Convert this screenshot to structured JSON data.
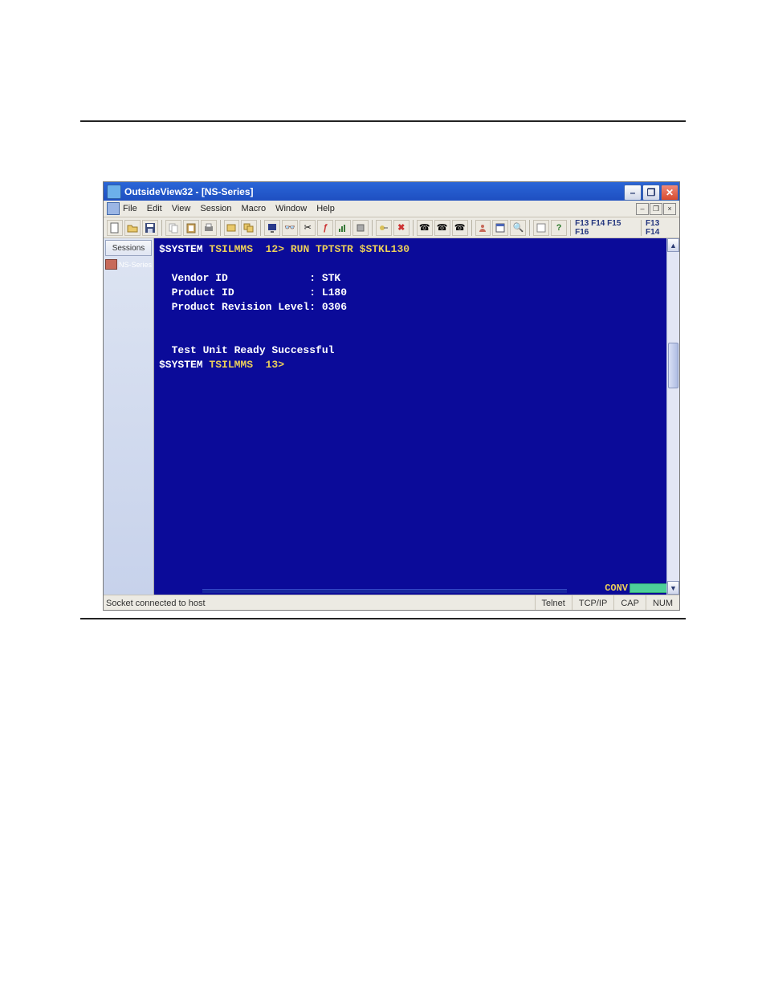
{
  "toplink_text": "",
  "app": {
    "title": "OutsideView32 - [NS-Series]"
  },
  "menu": {
    "items": [
      "File",
      "Edit",
      "View",
      "Session",
      "Macro",
      "Window",
      "Help"
    ]
  },
  "fkeys": {
    "group1": "F13 F14 F15 F16",
    "group2": "F13 F14"
  },
  "sidebar": {
    "tab_label": "Sessions",
    "item_label": "NS-Series"
  },
  "terminal": {
    "lines": [
      {
        "parts": [
          {
            "cls": "tw",
            "t": "$SYSTEM "
          },
          {
            "cls": "ty",
            "t": "TSILMMS  12> RUN TPTSTR $STKL130"
          }
        ]
      },
      {
        "parts": [
          {
            "cls": "tw",
            "t": ""
          }
        ]
      },
      {
        "parts": [
          {
            "cls": "tw",
            "t": "  Vendor ID             : STK"
          }
        ]
      },
      {
        "parts": [
          {
            "cls": "tw",
            "t": "  Product ID            : L180"
          }
        ]
      },
      {
        "parts": [
          {
            "cls": "tw",
            "t": "  Product Revision Level: 0306"
          }
        ]
      },
      {
        "parts": [
          {
            "cls": "tw",
            "t": ""
          }
        ]
      },
      {
        "parts": [
          {
            "cls": "tw",
            "t": ""
          }
        ]
      },
      {
        "parts": [
          {
            "cls": "tw",
            "t": "  Test Unit Ready Successful"
          }
        ]
      },
      {
        "parts": [
          {
            "cls": "tw",
            "t": "$SYSTEM "
          },
          {
            "cls": "ty",
            "t": "TSILMMS  13>"
          }
        ]
      }
    ],
    "conv_label": "CONV"
  },
  "status": {
    "left": "Socket connected to host",
    "p1": "Telnet",
    "p2": "TCP/IP",
    "p3": "CAP",
    "p4": "NUM"
  }
}
